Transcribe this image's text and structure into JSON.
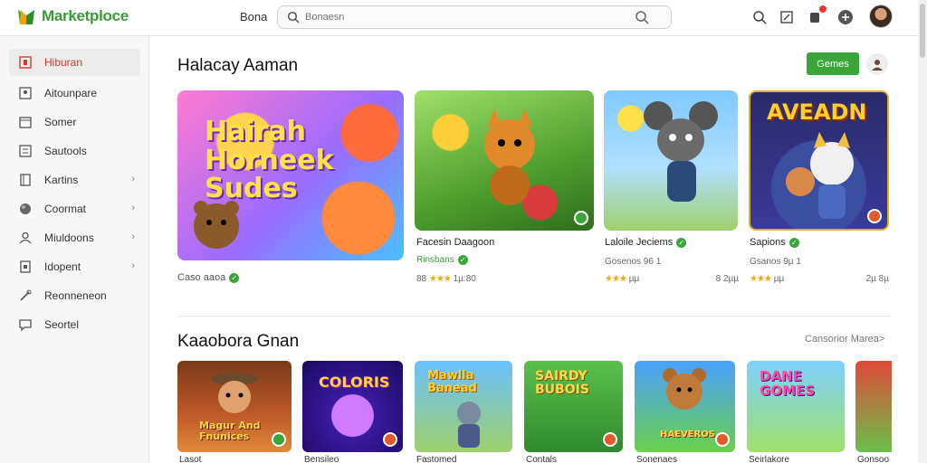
{
  "app": {
    "logo_text": "Marketploce",
    "top_link": "Bona",
    "search_placeholder": "Bonaesn"
  },
  "sidebar": {
    "items": [
      {
        "label": "Hiburan",
        "icon": "square-icon",
        "active": true,
        "chevron": false
      },
      {
        "label": "Aitounpare",
        "icon": "user-square-icon",
        "active": false,
        "chevron": false
      },
      {
        "label": "Somer",
        "icon": "calendar-icon",
        "active": false,
        "chevron": false
      },
      {
        "label": "Sautools",
        "icon": "list-icon",
        "active": false,
        "chevron": false
      },
      {
        "label": "Kartins",
        "icon": "book-icon",
        "active": false,
        "chevron": true
      },
      {
        "label": "Coormat",
        "icon": "globe-icon",
        "active": false,
        "chevron": true
      },
      {
        "label": "Miuldoons",
        "icon": "person-icon",
        "active": false,
        "chevron": true
      },
      {
        "label": "Idopent",
        "icon": "doc-icon",
        "active": false,
        "chevron": true
      },
      {
        "label": "Reonneneon",
        "icon": "tools-icon",
        "active": false,
        "chevron": false
      },
      {
        "label": "Seortel",
        "icon": "chat-icon",
        "active": false,
        "chevron": false
      }
    ]
  },
  "featured": {
    "title": "Halacay Aaman",
    "games_button": "Gemes",
    "cards": [
      {
        "name": "Caso aaoa",
        "sub": "",
        "meta_left": "",
        "meta_right": "",
        "art_title": "Hairah Horneek Sudes"
      },
      {
        "name": "Facesin Daagoon",
        "sub": "Rinsbans",
        "meta_left": "88",
        "stars": "★★★",
        "meta_right": "1µ:80",
        "art_title": ""
      },
      {
        "name": "Laloile Jeciems",
        "sub": "Gosenos 96  1",
        "meta_left": "",
        "stars": "★★★",
        "meta_right_a": "µµ",
        "meta_right": "8 2µµ",
        "art_title": ""
      },
      {
        "name": "Sapions",
        "sub": "Gsanos 9µ  1",
        "meta_left": "",
        "stars": "★★★",
        "meta_right_a": "µµ",
        "meta_right": "2µ 8µ",
        "art_title": "AVEADN"
      }
    ]
  },
  "recommended": {
    "title": "Kaaobora Gnan",
    "see_more": "Cansorior Marea>",
    "thumbs": [
      {
        "art_title": "Magur And Fnunices",
        "caption": "Lasot"
      },
      {
        "art_title": "COLORIS",
        "caption": "Bensileo"
      },
      {
        "art_title": "Mawlla Banead",
        "caption": "Fastomed"
      },
      {
        "art_title": "SAIRDY BUBOIS",
        "caption": "Contals"
      },
      {
        "art_title": "HAEVEROS",
        "caption": "Sonenaes"
      },
      {
        "art_title": "DANE GOMES",
        "caption": "Seirlakore"
      },
      {
        "art_title": "",
        "caption": "Gonsoo"
      }
    ]
  }
}
